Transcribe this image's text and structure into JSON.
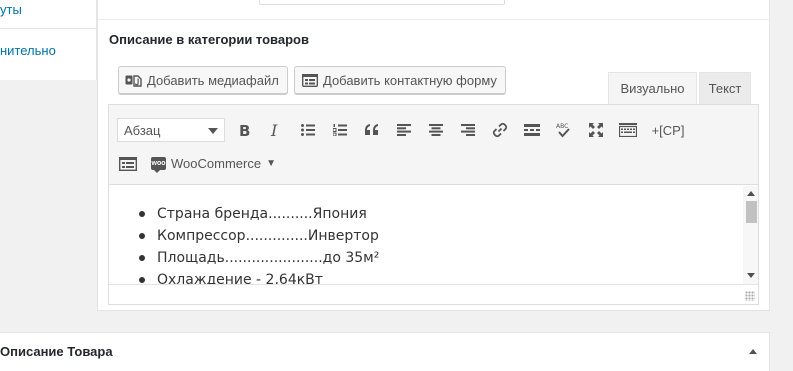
{
  "sidebar": {
    "items": [
      {
        "label": "уты"
      },
      {
        "label": "нительно"
      }
    ]
  },
  "section": {
    "title": "Описание в категории товаров"
  },
  "buttons": {
    "add_media": "Добавить медиафайл",
    "add_contact_form": "Добавить контактную форму"
  },
  "tabs": {
    "visual": "Визуально",
    "text": "Текст"
  },
  "toolbar": {
    "format_select": "Абзац",
    "icons": [
      "bold-icon",
      "italic-icon",
      "bullet-list-icon",
      "numbered-list-icon",
      "blockquote-icon",
      "align-left-icon",
      "align-center-icon",
      "align-right-icon",
      "link-icon",
      "read-more-icon",
      "spellcheck-icon",
      "fullscreen-icon",
      "keyboard-icon"
    ],
    "shortcode": "+[CP]",
    "woocommerce": "WooCommerce"
  },
  "content": {
    "items": [
      "Страна бренда..........Япония",
      "Компрессор..............Инвертор",
      "Площадь......................до 35м²",
      "Охлаждение - 2,64кВт"
    ]
  },
  "postbox": {
    "title": "Описание Товара"
  },
  "colors": {
    "link": "#0073aa",
    "background": "#f1f1f1"
  }
}
